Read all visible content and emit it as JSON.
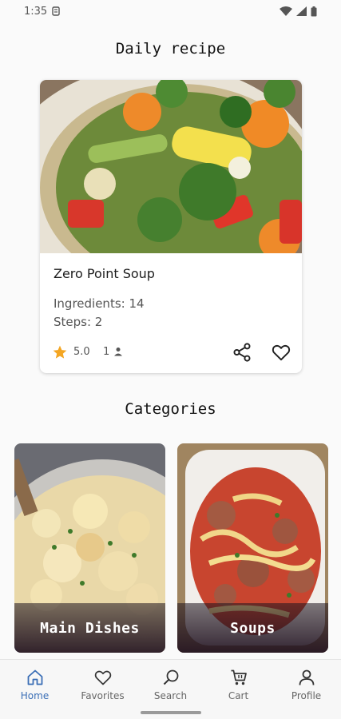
{
  "status_bar": {
    "time": "1:35",
    "icons": [
      "sim-icon",
      "wifi-icon",
      "signal-icon",
      "battery-icon"
    ]
  },
  "daily": {
    "section_title": "Daily recipe",
    "recipe": {
      "title": "Zero Point Soup",
      "ingredients_text": "Ingredients: 14",
      "steps_text": "Steps: 2",
      "rating": "5.0",
      "reviews": "1",
      "image": "vegetable-soup-photo"
    }
  },
  "categories": {
    "section_title": "Categories",
    "items": [
      {
        "label": "Main Dishes",
        "image": "pasta-casserole-photo"
      },
      {
        "label": "Soups",
        "image": "meatball-noodle-soup-photo"
      }
    ]
  },
  "bottom_nav": {
    "items": [
      {
        "label": "Home",
        "icon": "home-icon",
        "active": true
      },
      {
        "label": "Favorites",
        "icon": "heart-icon",
        "active": false
      },
      {
        "label": "Search",
        "icon": "search-icon",
        "active": false
      },
      {
        "label": "Cart",
        "icon": "cart-icon",
        "active": false
      },
      {
        "label": "Profile",
        "icon": "person-icon",
        "active": false
      }
    ]
  },
  "colors": {
    "accent": "#3b6fb6",
    "star": "#f4a623",
    "background": "#fafafa"
  }
}
